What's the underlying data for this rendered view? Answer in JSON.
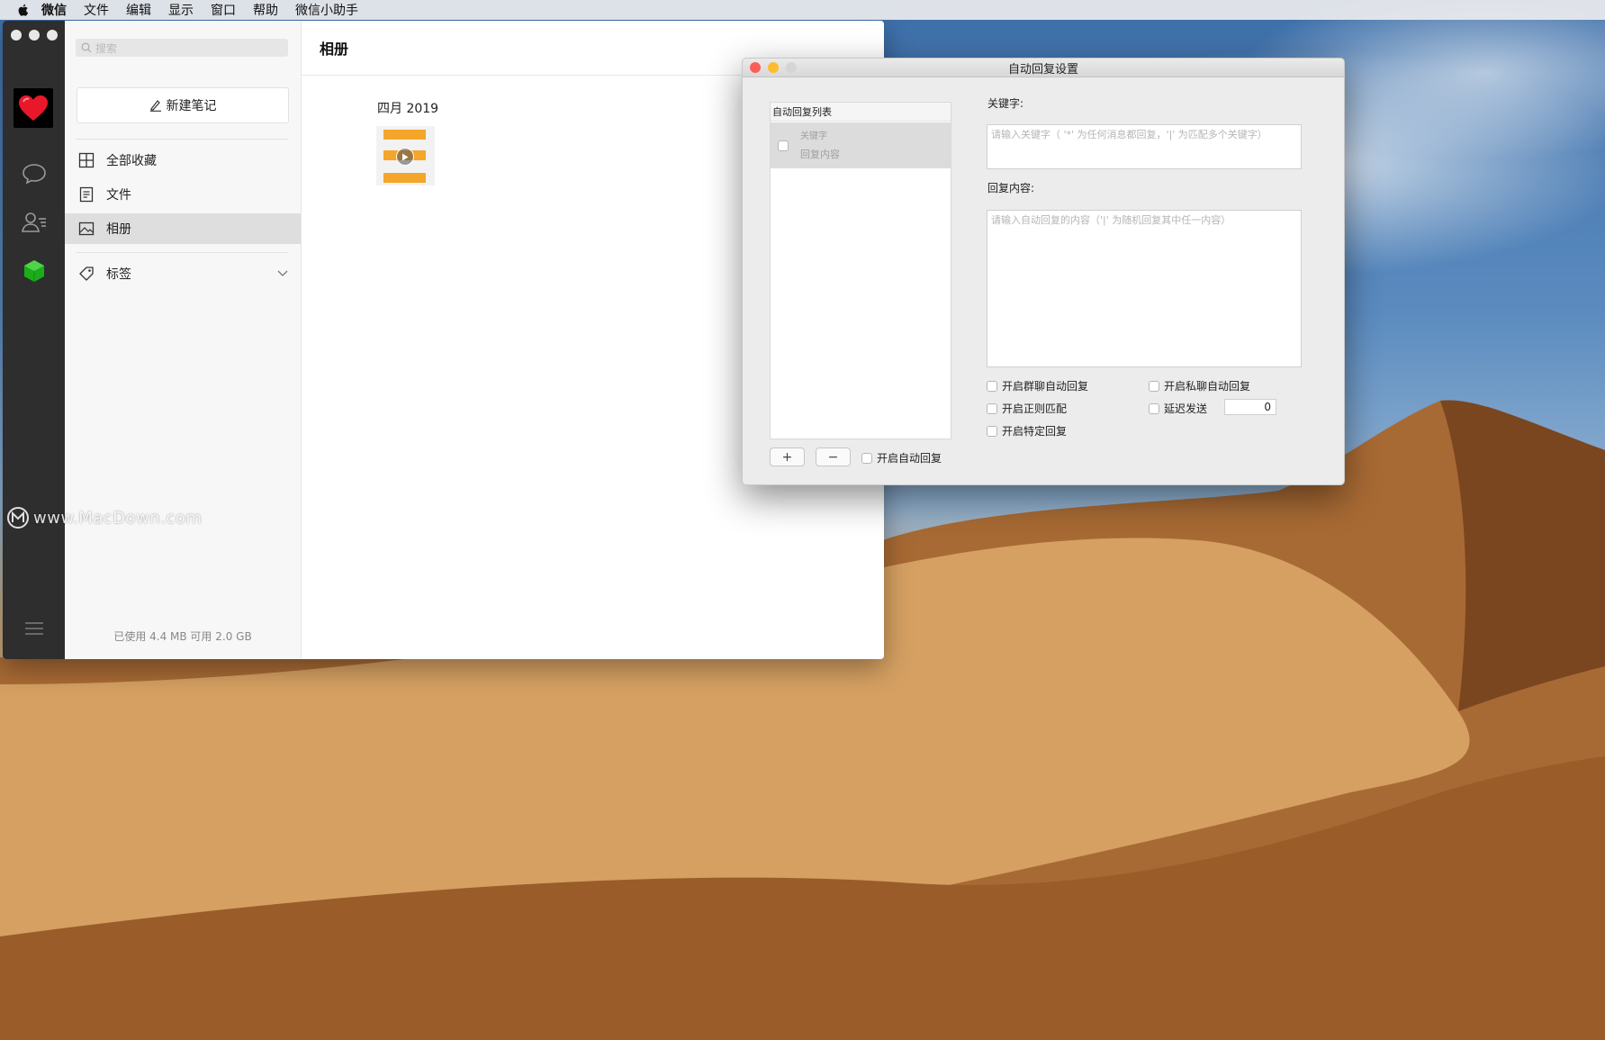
{
  "menubar": {
    "items": [
      "微信",
      "文件",
      "编辑",
      "显示",
      "窗口",
      "帮助",
      "微信小助手"
    ]
  },
  "wechat": {
    "watermark": "www.MacDown.com",
    "search_placeholder": "搜索",
    "new_note_label": "新建笔记",
    "nav": [
      {
        "label": "全部收藏",
        "icon": "grid-icon"
      },
      {
        "label": "文件",
        "icon": "document-icon"
      },
      {
        "label": "相册",
        "icon": "image-icon",
        "active": true
      },
      {
        "label": "标签",
        "icon": "tag-icon"
      }
    ],
    "storage": "已使用 4.4 MB 可用 2.0 GB",
    "main_title": "相册",
    "month": "四月 2019"
  },
  "dialog": {
    "title": "自动回复设置",
    "list_header": "自动回复列表",
    "list_row": {
      "keyword": "关键字",
      "reply": "回复内容"
    },
    "add_label": "+",
    "remove_label": "−",
    "enable_auto_reply": "开启自动回复",
    "keyword_label": "关键字:",
    "keyword_placeholder": "请输入关键字（ '*' 为任何消息都回复，'|' 为匹配多个关键字）",
    "reply_label": "回复内容:",
    "reply_placeholder": "请输入自动回复的内容（'|' 为随机回复其中任一内容）",
    "options": {
      "group_reply": "开启群聊自动回复",
      "private_reply": "开启私聊自动回复",
      "regex": "开启正则匹配",
      "delay": "延迟发送",
      "specific": "开启特定回复"
    },
    "delay_value": "0"
  },
  "colors": {
    "rail": "#2e2e2e",
    "accent_green": "#1aad19",
    "close": "#fc5f57",
    "minimize": "#fdbc2e"
  }
}
